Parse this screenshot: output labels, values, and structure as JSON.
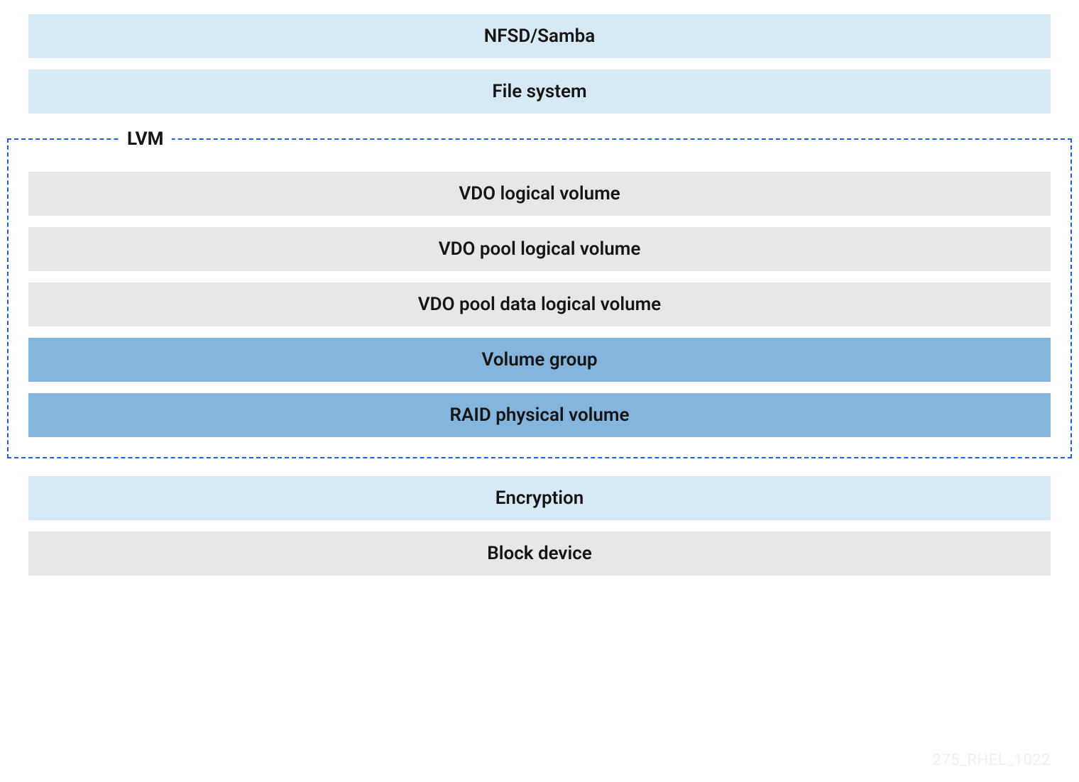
{
  "layers": {
    "top": [
      {
        "label": "NFSD/Samba",
        "style": "lightblue"
      },
      {
        "label": "File system",
        "style": "lightblue"
      }
    ],
    "lvm_label": "LVM",
    "lvm": [
      {
        "label": "VDO logical volume",
        "style": "gray"
      },
      {
        "label": "VDO pool logical volume",
        "style": "gray"
      },
      {
        "label": "VDO pool data logical volume",
        "style": "gray"
      },
      {
        "label": "Volume group",
        "style": "blue"
      },
      {
        "label": "RAID physical volume",
        "style": "blue"
      }
    ],
    "bottom": [
      {
        "label": "Encryption",
        "style": "lightblue"
      },
      {
        "label": "Block device",
        "style": "gray"
      }
    ]
  },
  "watermark": "275_RHEL_1022"
}
